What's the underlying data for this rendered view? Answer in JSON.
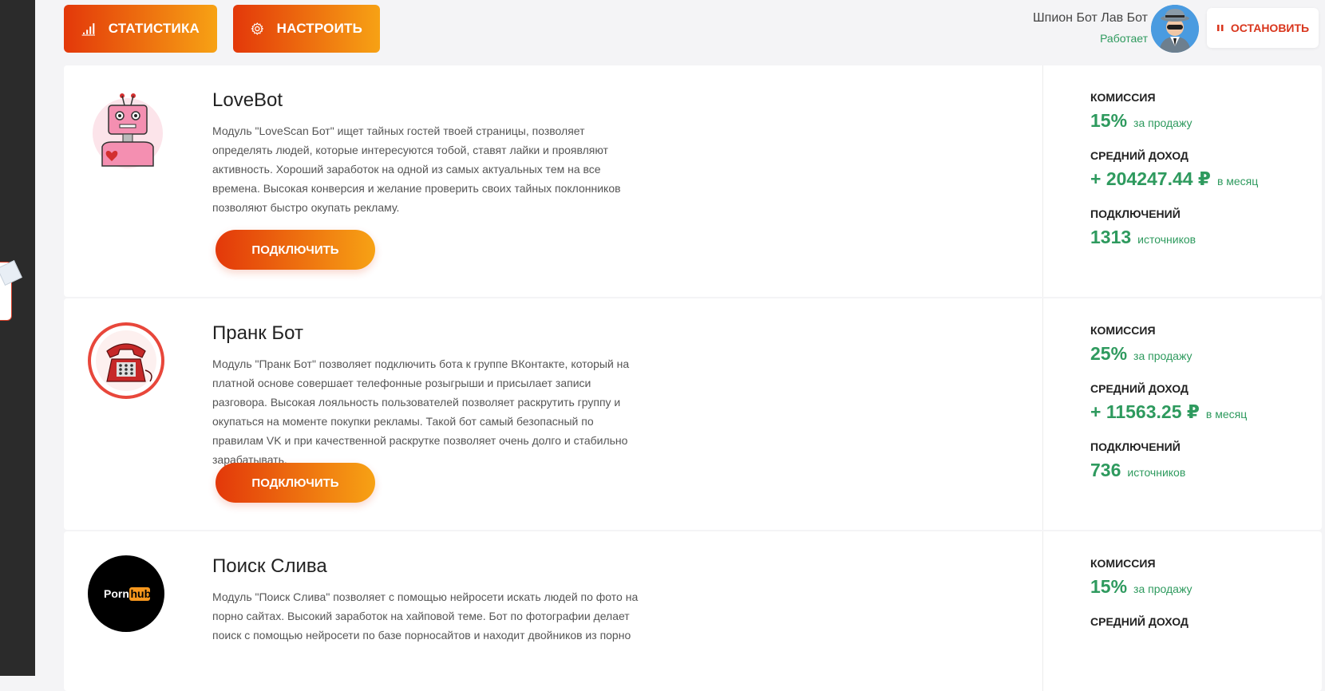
{
  "topbar": {
    "stats_label": "СТАТИСТИКА",
    "settings_label": "НАСТРОИТЬ",
    "bot_name": "Шпион Бот Лав Бот",
    "bot_status": "Работает",
    "stop_label": "ОСТАНОВИТЬ"
  },
  "modules": [
    {
      "title": "LoveBot",
      "description": "Модуль \"LoveScan Бот\" ищет тайных гостей твоей страницы, позволяет определять людей, которые интересуются тобой, ставят лайки и проявляют активность. Хороший заработок на одной из самых актуальных тем на все времена. Высокая конверсия и желание проверить своих тайных поклонников позволяют быстро окупать рекламу.",
      "connect_label": "ПОДКЛЮЧИТЬ",
      "commission_label": "КОМИССИЯ",
      "commission_value": "15%",
      "commission_unit": "за продажу",
      "income_label": "СРЕДНИЙ ДОХОД",
      "income_value": "+ 204247.44 ₽",
      "income_unit": "в месяц",
      "connections_label": "ПОДКЛЮЧЕНИЙ",
      "connections_value": "1313",
      "connections_unit": "источников"
    },
    {
      "title": "Пранк Бот",
      "description": "Модуль \"Пранк Бот\" позволяет подключить бота к группе ВКонтакте, который на платной основе совершает телефонные розыгрыши и присылает записи разговора. Высокая лояльность пользователей позволяет раскрутить группу и окупаться на моменте покупки рекламы. Такой бот самый безопасный по правилам VK и при качественной раскрутке позволяет очень долго и стабильно зарабатывать.",
      "connect_label": "ПОДКЛЮЧИТЬ",
      "commission_label": "КОМИССИЯ",
      "commission_value": "25%",
      "commission_unit": "за продажу",
      "income_label": "СРЕДНИЙ ДОХОД",
      "income_value": "+ 11563.25 ₽",
      "income_unit": "в месяц",
      "connections_label": "ПОДКЛЮЧЕНИЙ",
      "connections_value": "736",
      "connections_unit": "источников"
    },
    {
      "title": "Поиск Слива",
      "description": "Модуль \"Поиск Слива\" позволяет с помощью нейросети искать людей по фото на порно сайтах. Высокий заработок на хайповой теме. Бот по фотографии делает поиск с помощью нейросети по базе порносайтов и находит двойников из порно",
      "logo_text_1": "Porn",
      "logo_text_2": "hub",
      "commission_label": "КОМИССИЯ",
      "commission_value": "15%",
      "commission_unit": "за продажу",
      "income_label": "СРЕДНИЙ ДОХОД"
    }
  ]
}
